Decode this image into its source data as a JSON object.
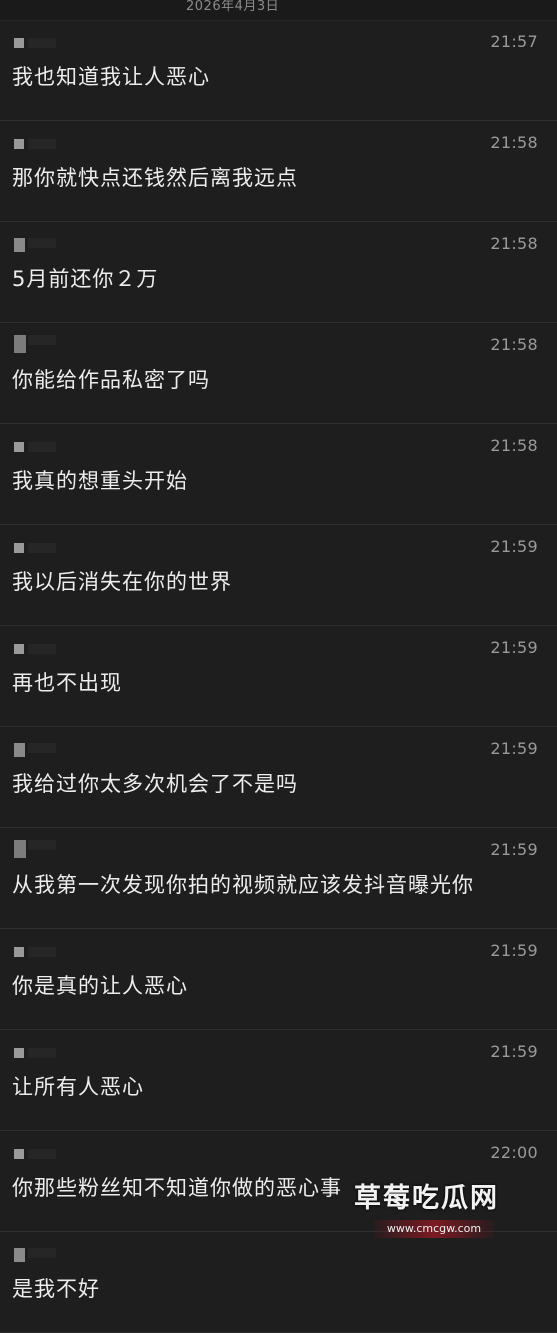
{
  "header": {
    "date": "2026年4月3日"
  },
  "messages": [
    {
      "time": "21:57",
      "text": "我也知道我让人恶心"
    },
    {
      "time": "21:58",
      "text": "那你就快点还钱然后离我远点"
    },
    {
      "time": "21:58",
      "text": "5月前还你２万"
    },
    {
      "time": "21:58",
      "text": "你能给作品私密了吗"
    },
    {
      "time": "21:58",
      "text": "我真的想重头开始"
    },
    {
      "time": "21:59",
      "text": "我以后消失在你的世界"
    },
    {
      "time": "21:59",
      "text": "再也不出现"
    },
    {
      "time": "21:59",
      "text": "我给过你太多次机会了不是吗"
    },
    {
      "time": "21:59",
      "text": "从我第一次发现你拍的视频就应该发抖音曝光你"
    },
    {
      "time": "21:59",
      "text": "你是真的让人恶心"
    },
    {
      "time": "21:59",
      "text": "让所有人恶心"
    },
    {
      "time": "22:00",
      "text": "你那些粉丝知不知道你做的恶心事"
    },
    {
      "time": "",
      "text": "是我不好"
    }
  ],
  "watermark": {
    "title": "草莓吃瓜网",
    "url": "www.cmcgw.com"
  }
}
